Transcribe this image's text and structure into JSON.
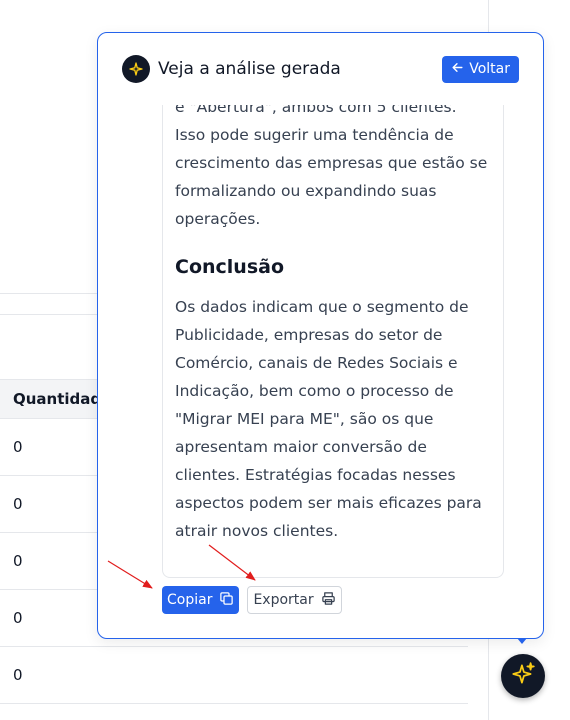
{
  "background": {
    "table": {
      "column_header": "Quantidad",
      "rows": [
        "0",
        "0",
        "0",
        "0",
        "0"
      ]
    }
  },
  "dialog": {
    "title": "Veja a análise gerada",
    "back_label": "Voltar",
    "paragraph_1": "e \"Abertura\", ambos com 5 clientes. Isso pode sugerir uma tendência de crescimento das empresas que estão se formalizando ou expandindo suas operações.",
    "conclusion_heading": "Conclusão",
    "paragraph_2": "Os dados indicam que o segmento de Publicidade, empresas do setor de Comércio, canais de Redes Sociais e Indicação, bem como o processo de \"Migrar MEI para ME\", são os que apresentam maior conversão de clientes. Estratégias focadas nesses aspectos podem ser mais eficazes para atrair novos clientes.",
    "copy_label": "Copiar",
    "export_label": "Exportar"
  },
  "icons": {
    "header": "sparkle-icon",
    "back": "arrow-left-icon",
    "copy": "copy-icon",
    "export": "printer-icon",
    "fab": "sparkle-icon"
  },
  "colors": {
    "accent": "#2563eb",
    "dark": "#111827",
    "sparkle": "#facc15",
    "annotation_arrow": "#e11d1d"
  }
}
